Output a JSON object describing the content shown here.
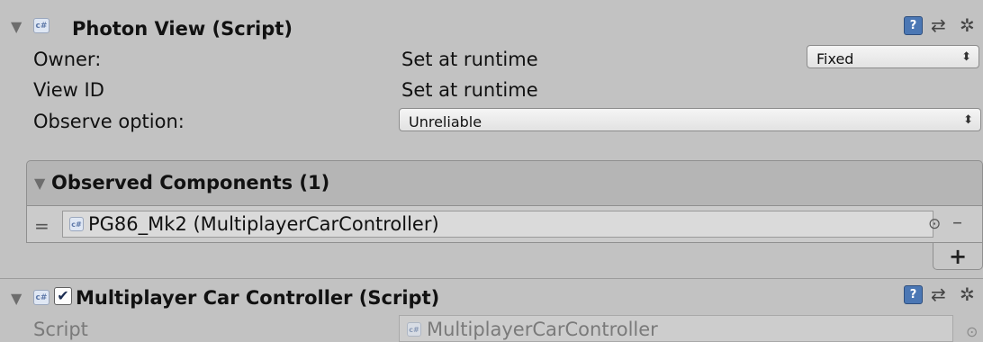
{
  "photon_view": {
    "title": "Photon View (Script)",
    "fields": [
      {
        "label": "Owner:",
        "value": "Set at runtime",
        "dropdown": "Fixed"
      },
      {
        "label": "View ID",
        "value": "Set at runtime"
      },
      {
        "label": "Observe option:",
        "dropdown": "Unreliable"
      }
    ],
    "observed": {
      "header": "Observed Components (1)",
      "item": "PG86_Mk2 (MultiplayerCarController)",
      "drag_glyph": "=",
      "picker_glyph": "⊙",
      "remove_glyph": "–",
      "add_glyph": "+"
    }
  },
  "car_controller": {
    "title": "Multiplayer Car Controller (Script)",
    "script_label": "Script",
    "script_value": "MultiplayerCarController",
    "picker_glyph": "⊙"
  },
  "glyphs": {
    "fold_open": "▼",
    "help": "?",
    "preset": "⇄",
    "gear": "✲",
    "check": "✔",
    "dropdown_arrow": "⬍",
    "cs_icon": "c#"
  }
}
